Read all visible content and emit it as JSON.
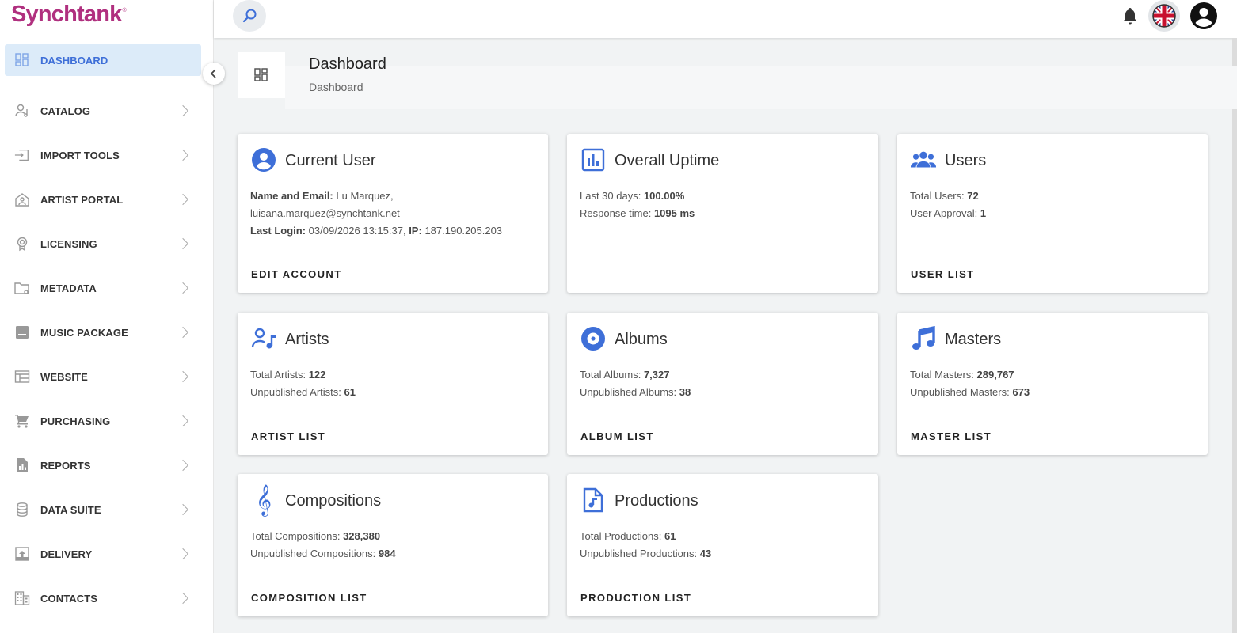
{
  "app": {
    "logo": "Synchtank",
    "logo_mark": "®"
  },
  "sidebar": {
    "items": [
      {
        "label": "DASHBOARD",
        "icon": "dashboard-icon",
        "active": true
      },
      {
        "label": "CATALOG",
        "icon": "catalog-icon"
      },
      {
        "label": "IMPORT TOOLS",
        "icon": "import-icon"
      },
      {
        "label": "ARTIST PORTAL",
        "icon": "artist-portal-icon"
      },
      {
        "label": "LICENSING",
        "icon": "licensing-icon"
      },
      {
        "label": "METADATA",
        "icon": "metadata-icon"
      },
      {
        "label": "MUSIC PACKAGE",
        "icon": "music-package-icon"
      },
      {
        "label": "WEBSITE",
        "icon": "website-icon"
      },
      {
        "label": "PURCHASING",
        "icon": "cart-icon"
      },
      {
        "label": "REPORTS",
        "icon": "reports-icon"
      },
      {
        "label": "DATA SUITE",
        "icon": "database-icon"
      },
      {
        "label": "DELIVERY",
        "icon": "delivery-icon"
      },
      {
        "label": "CONTACTS",
        "icon": "contacts-icon"
      }
    ]
  },
  "header": {
    "title": "Dashboard",
    "breadcrumb": "Dashboard"
  },
  "colors": {
    "brand": "#b0307f",
    "accent": "#3e6fd8",
    "active_bg": "#dcebf9"
  },
  "cards": {
    "current_user": {
      "title": "Current User",
      "name_label": "Name and Email:",
      "name_value": "Lu Marquez,",
      "email": "luisana.marquez@synchtank.net",
      "login_label": "Last Login:",
      "login_value": "03/09/2026 13:15:37,",
      "ip_label": "IP:",
      "ip_value": "187.190.205.203",
      "action": "EDIT ACCOUNT"
    },
    "uptime": {
      "title": "Overall Uptime",
      "l1_label": "Last 30 days:",
      "l1_value": "100.00%",
      "l2_label": "Response time:",
      "l2_value": "1095 ms"
    },
    "users": {
      "title": "Users",
      "l1_label": "Total Users:",
      "l1_value": "72",
      "l2_label": "User Approval:",
      "l2_value": "1",
      "action": "USER LIST"
    },
    "artists": {
      "title": "Artists",
      "l1_label": "Total Artists:",
      "l1_value": "122",
      "l2_label": "Unpublished Artists:",
      "l2_value": "61",
      "action": "ARTIST LIST"
    },
    "albums": {
      "title": "Albums",
      "l1_label": "Total Albums:",
      "l1_value": "7,327",
      "l2_label": "Unpublished Albums:",
      "l2_value": "38",
      "action": "ALBUM LIST"
    },
    "masters": {
      "title": "Masters",
      "l1_label": "Total Masters:",
      "l1_value": "289,767",
      "l2_label": "Unpublished Masters:",
      "l2_value": "673",
      "action": "MASTER LIST"
    },
    "compositions": {
      "title": "Compositions",
      "l1_label": "Total Compositions:",
      "l1_value": "328,380",
      "l2_label": "Unpublished Compositions:",
      "l2_value": "984",
      "action": "COMPOSITION LIST"
    },
    "productions": {
      "title": "Productions",
      "l1_label": "Total Productions:",
      "l1_value": "61",
      "l2_label": "Unpublished Productions:",
      "l2_value": "43",
      "action": "PRODUCTION LIST"
    }
  }
}
